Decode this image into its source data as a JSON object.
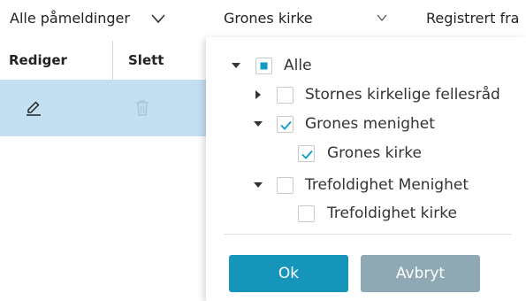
{
  "filters": {
    "registrations": "Alle påmeldinger",
    "church": "Grones kirke",
    "registered_from": "Registrert fra"
  },
  "table": {
    "headers": {
      "edit": "Rediger",
      "delete": "Slett"
    }
  },
  "tree": {
    "items": [
      {
        "label": "Alle",
        "state": "indeterminate",
        "caret": "down"
      },
      {
        "label": "Stornes kirkelige fellesråd",
        "state": "unchecked",
        "caret": "right"
      },
      {
        "label": "Grones menighet",
        "state": "checked",
        "caret": "down"
      },
      {
        "label": "Grones kirke",
        "state": "checked",
        "caret": "none"
      },
      {
        "label": "Trefoldighet Menighet",
        "state": "unchecked",
        "caret": "down"
      },
      {
        "label": "Trefoldighet kirke",
        "state": "unchecked",
        "caret": "none"
      }
    ]
  },
  "buttons": {
    "ok": "Ok",
    "cancel": "Avbryt"
  },
  "colors": {
    "accent": "#0e9cc6",
    "ok_button": "#1695bb",
    "cancel_button": "#8fa9b4",
    "selected_row": "#c3dff2"
  },
  "icons": {
    "filter_chevron": "chevron-down-icon",
    "edit": "pencil-icon",
    "delete": "trash-icon"
  }
}
